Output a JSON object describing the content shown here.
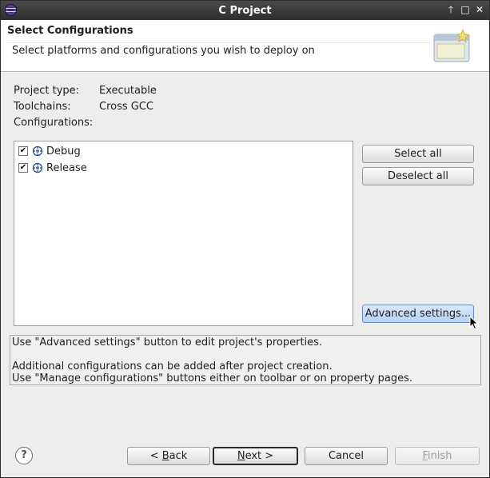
{
  "window": {
    "title": "C Project"
  },
  "header": {
    "title": "Select Configurations",
    "description": "Select platforms and configurations you wish to deploy on"
  },
  "info": {
    "project_type_label": "Project type:",
    "project_type_value": "Executable",
    "toolchains_label": "Toolchains:",
    "toolchains_value": "Cross GCC",
    "configurations_label": "Configurations:"
  },
  "configurations": [
    {
      "label": "Debug",
      "checked": true
    },
    {
      "label": "Release",
      "checked": true
    }
  ],
  "buttons": {
    "select_all": "Select all",
    "deselect_all": "Deselect all",
    "advanced_settings": "Advanced settings...",
    "back_prefix": "< ",
    "back_mnemonic": "B",
    "back_rest": "ack",
    "next_mnemonic": "N",
    "next_rest": "ext >",
    "cancel": "Cancel",
    "finish_mnemonic": "F",
    "finish_rest": "inish"
  },
  "info_box": {
    "line1": "Use \"Advanced settings\" button to edit project's properties.",
    "line2": "",
    "line3": "Additional configurations can be added after project creation.",
    "line4": "Use \"Manage configurations\" buttons either on toolbar or on property pages."
  },
  "icons": {
    "app": "eclipse-icon",
    "config": "configuration-icon",
    "help": "help-icon",
    "check_glyph": "✔",
    "help_glyph": "?",
    "close_glyph": "✕",
    "maximize_glyph": "□",
    "restore_glyph": "🞁"
  },
  "colors": {
    "titlebar": "#3a3a3a",
    "hover_button": "#b6d2f3",
    "dialog_bg": "#ededed"
  }
}
